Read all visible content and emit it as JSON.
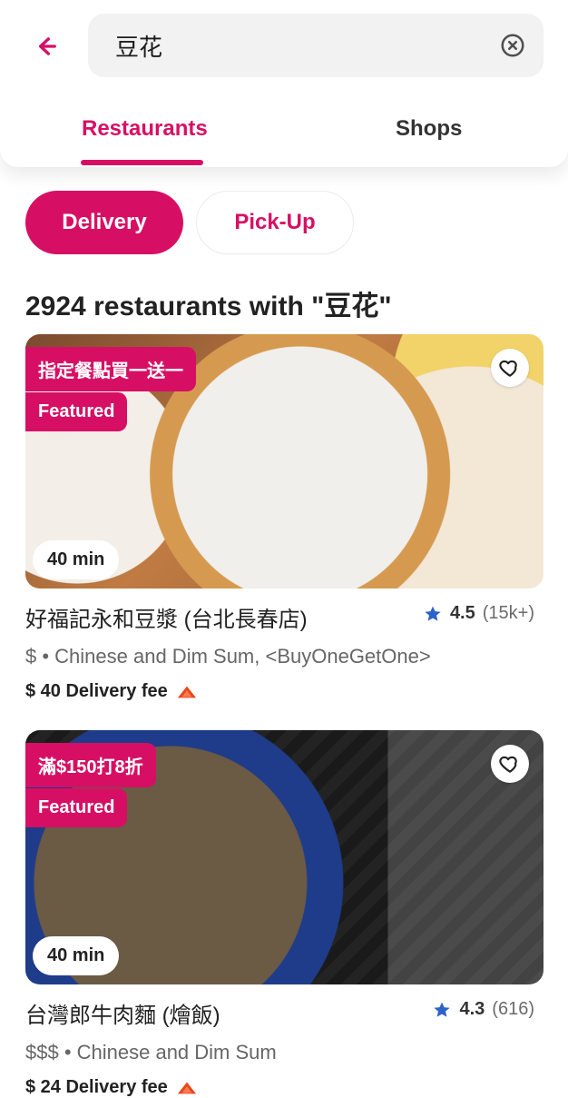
{
  "header": {
    "search_value": "豆花",
    "tabs": [
      {
        "label": "Restaurants"
      },
      {
        "label": "Shops"
      }
    ]
  },
  "filters": {
    "delivery_label": "Delivery",
    "pickup_label": "Pick-Up"
  },
  "results": {
    "title": "2924 restaurants with \"豆花\""
  },
  "restaurants": [
    {
      "promo_tag": "指定餐點買一送一",
      "featured_label": "Featured",
      "time": "40 min",
      "name": "好福記永和豆漿 (台北長春店)",
      "rating": "4.5",
      "rating_count": "(15k+)",
      "meta": "$ • Chinese and Dim Sum, <BuyOneGetOne>",
      "delivery_fee": "$ 40 Delivery fee"
    },
    {
      "promo_tag": "滿$150打8折",
      "featured_label": "Featured",
      "time": "40 min",
      "name": "台灣郎牛肉麵 (燴飯)",
      "rating": "4.3",
      "rating_count": "(616)",
      "meta": "$$$ • Chinese and Dim Sum",
      "delivery_fee": "$ 24 Delivery fee"
    }
  ],
  "icons": {
    "back": "arrow-left-icon",
    "clear": "clear-icon",
    "heart": "heart-icon",
    "star": "star-icon",
    "surge": "surge-icon"
  },
  "colors": {
    "brand": "#D70F64",
    "chip_bg": "#F2F2F2"
  }
}
